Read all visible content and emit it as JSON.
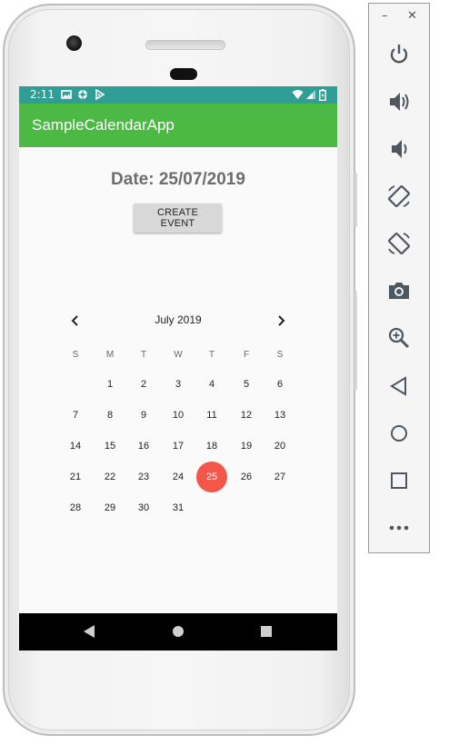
{
  "status_bar": {
    "time": "2:11",
    "icons": [
      "image-icon",
      "sync-icon",
      "play-icon",
      "wifi-icon",
      "signal-icon",
      "battery-icon"
    ]
  },
  "app_bar": {
    "title": "SampleCalendarApp"
  },
  "content": {
    "date_label": "Date: 25/07/2019",
    "create_button": "CREATE EVENT"
  },
  "calendar": {
    "month_label": "July 2019",
    "weekdays": [
      "S",
      "M",
      "T",
      "W",
      "T",
      "F",
      "S"
    ],
    "first_weekday_index": 1,
    "days_in_month": 31,
    "selected_day": 25,
    "selected_color": "#f4574a"
  },
  "navigation_bar": [
    "back-icon",
    "home-icon",
    "recents-icon"
  ],
  "emulator_panel": {
    "window_controls": [
      "minimize",
      "close"
    ],
    "minimize_glyph": "–",
    "close_glyph": "✕",
    "buttons": [
      "power-icon",
      "volume-up-icon",
      "volume-down-icon",
      "rotate-left-icon",
      "rotate-right-icon",
      "camera-icon",
      "zoom-icon",
      "back-icon",
      "home-icon",
      "overview-icon",
      "more-icon"
    ]
  },
  "colors": {
    "status_bar": "#2e9e96",
    "app_bar": "#4cb944",
    "accent": "#f4574a"
  }
}
